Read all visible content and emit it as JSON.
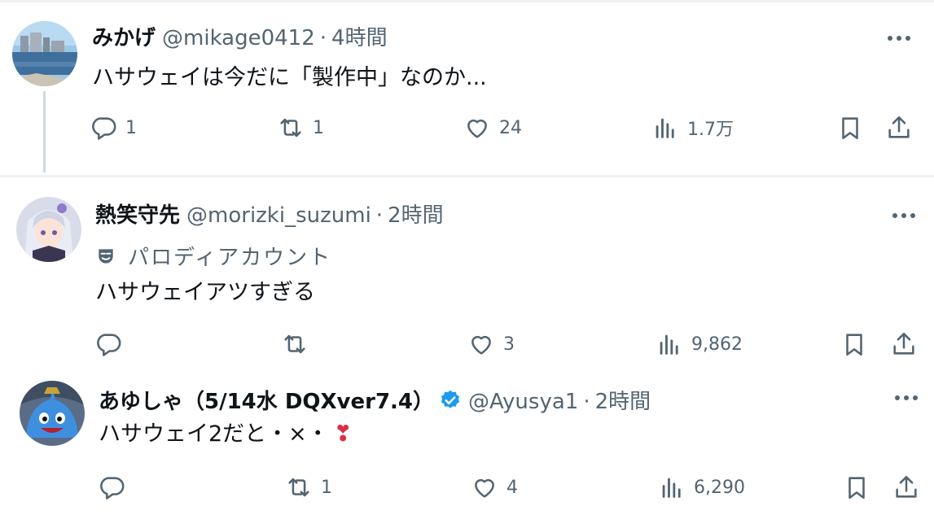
{
  "tweets": [
    {
      "name": "みかげ",
      "handle": "@mikage0412",
      "separator": "·",
      "time": "4時間",
      "text": "ハサウェイは今だに「製作中」なのか...",
      "replies": "1",
      "retweets": "1",
      "likes": "24",
      "views": "1.7万"
    },
    {
      "name": "熱笑守先",
      "handle": "@morizki_suzumi",
      "separator": "·",
      "time": "2時間",
      "label": "パロディアカウント",
      "text": "ハサウェイアツすぎる",
      "replies": "",
      "retweets": "",
      "likes": "3",
      "views": "9,862"
    },
    {
      "name": "あゆしゃ（5/14水 DQXver7.4）",
      "handle": "@Ayusya1",
      "separator": "·",
      "time": "2時間",
      "text": "ハサウェイ2だと・×・",
      "emoji": "❣",
      "replies": "",
      "retweets": "1",
      "likes": "4",
      "views": "6,290"
    }
  ],
  "colors": {
    "text": "#0f1419",
    "secondary": "#536471",
    "verified": "#1d9bf0",
    "emoji_heart": "#dd2e44",
    "divider": "#eff3f4"
  },
  "icons": [
    "reply-icon",
    "retweet-icon",
    "like-icon",
    "views-icon",
    "bookmark-icon",
    "share-icon",
    "more-icon",
    "verified-badge-icon",
    "parody-mask-icon"
  ]
}
